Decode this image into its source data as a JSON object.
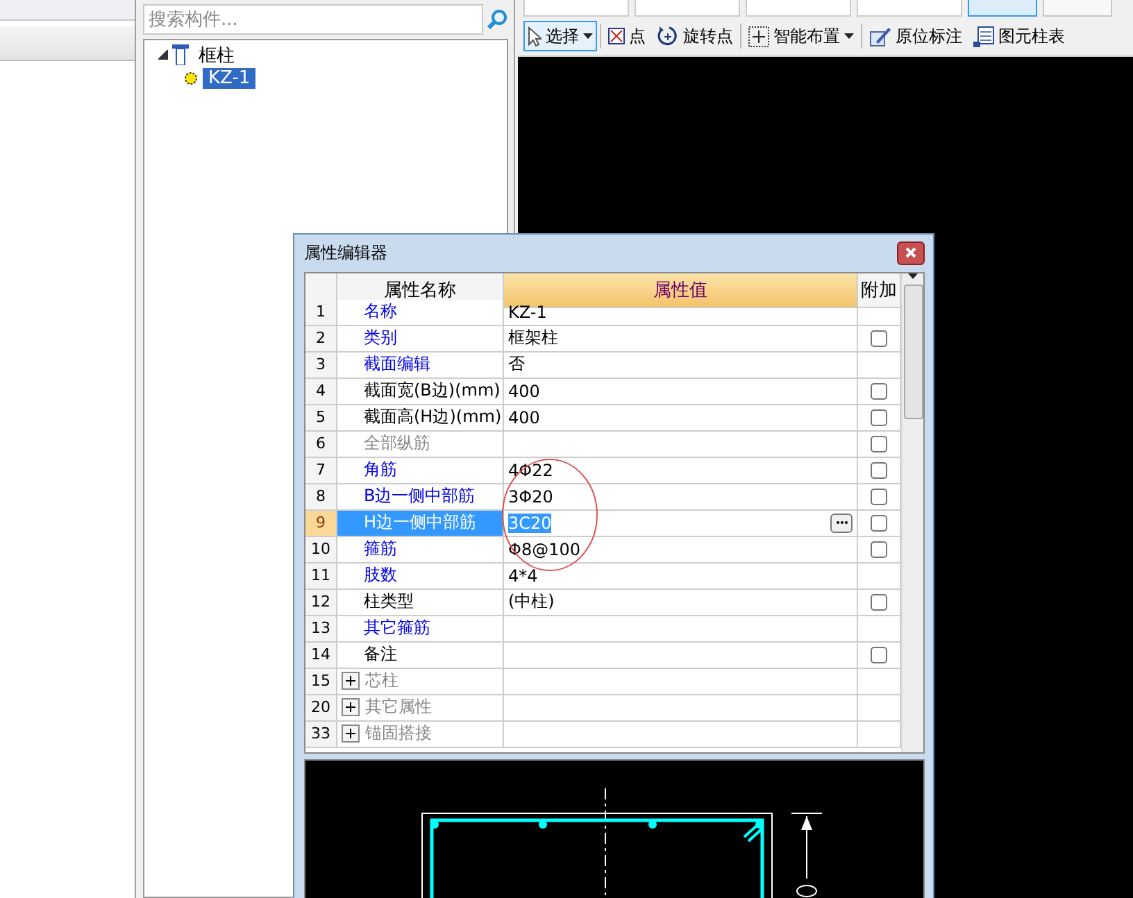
{
  "top_buttons": [
    {
      "pressed": true
    },
    {
      "pressed": false
    }
  ],
  "toolbar": [
    {
      "label": "选择",
      "kind": "cursor",
      "dropdown": true,
      "pressed": true
    },
    {
      "label": "点",
      "kind": "point",
      "dropdown": false,
      "pressed": false
    },
    {
      "label": "旋转点",
      "kind": "rotate",
      "dropdown": false,
      "pressed": false
    },
    {
      "label": "智能布置",
      "kind": "grid",
      "dropdown": true,
      "pressed": false
    },
    {
      "label": "原位标注",
      "kind": "pen",
      "dropdown": false,
      "pressed": false
    },
    {
      "label": "图元柱表",
      "kind": "table",
      "dropdown": false,
      "pressed": false
    }
  ],
  "search": {
    "placeholder": "搜索构件..."
  },
  "tree": [
    {
      "label": "框柱",
      "expanded": true,
      "selected": false,
      "children": [
        {
          "label": "KZ-1",
          "selected": true
        }
      ]
    }
  ],
  "dialog": {
    "title": "属性编辑器",
    "columns": [
      "属性名称",
      "属性值",
      "附加"
    ],
    "rows": [
      {
        "num": "1",
        "name": "名称",
        "value": "KZ-1",
        "kind": "link",
        "selected": false
      },
      {
        "num": "2",
        "name": "类别",
        "value": "框架柱",
        "kind": "link",
        "selected": false,
        "checked": false
      },
      {
        "num": "3",
        "name": "截面编辑",
        "value": "否",
        "kind": "link",
        "selected": false
      },
      {
        "num": "4",
        "name": "截面宽(B边)(mm)",
        "value": "400",
        "kind": "plain",
        "selected": false,
        "checked": false
      },
      {
        "num": "5",
        "name": "截面高(H边)(mm)",
        "value": "400",
        "kind": "plain",
        "selected": false,
        "checked": false
      },
      {
        "num": "6",
        "name": "全部纵筋",
        "kind": "disabled",
        "selected": false,
        "checked": false
      },
      {
        "num": "7",
        "name": "角筋",
        "value": "4Φ22",
        "kind": "link",
        "selected": false,
        "checked": false
      },
      {
        "num": "8",
        "name": "B边一侧中部筋",
        "value": "3Φ20",
        "kind": "link",
        "selected": false,
        "checked": false
      },
      {
        "num": "9",
        "name": "H边一侧中部筋",
        "value": "3C20",
        "kind": "link",
        "selected": true,
        "checked": false
      },
      {
        "num": "10",
        "name": "箍筋",
        "value": "Φ8@100",
        "kind": "link",
        "selected": false,
        "checked": false
      },
      {
        "num": "11",
        "name": "肢数",
        "value": "4*4",
        "kind": "link",
        "selected": false
      },
      {
        "num": "12",
        "name": "柱类型",
        "value": "(中柱)",
        "kind": "plain",
        "selected": false,
        "checked": false
      },
      {
        "num": "13",
        "name": "其它箍筋",
        "kind": "link",
        "selected": false
      },
      {
        "num": "14",
        "name": "备注",
        "kind": "plain",
        "selected": false,
        "checked": false
      },
      {
        "num": "15",
        "name": "芯柱",
        "kind": "group",
        "selected": false,
        "expanded": false
      },
      {
        "num": "20",
        "name": "其它属性",
        "kind": "group",
        "selected": false,
        "expanded": false
      },
      {
        "num": "33",
        "name": "锚固搭接",
        "kind": "group",
        "selected": false,
        "expanded": false
      }
    ]
  }
}
